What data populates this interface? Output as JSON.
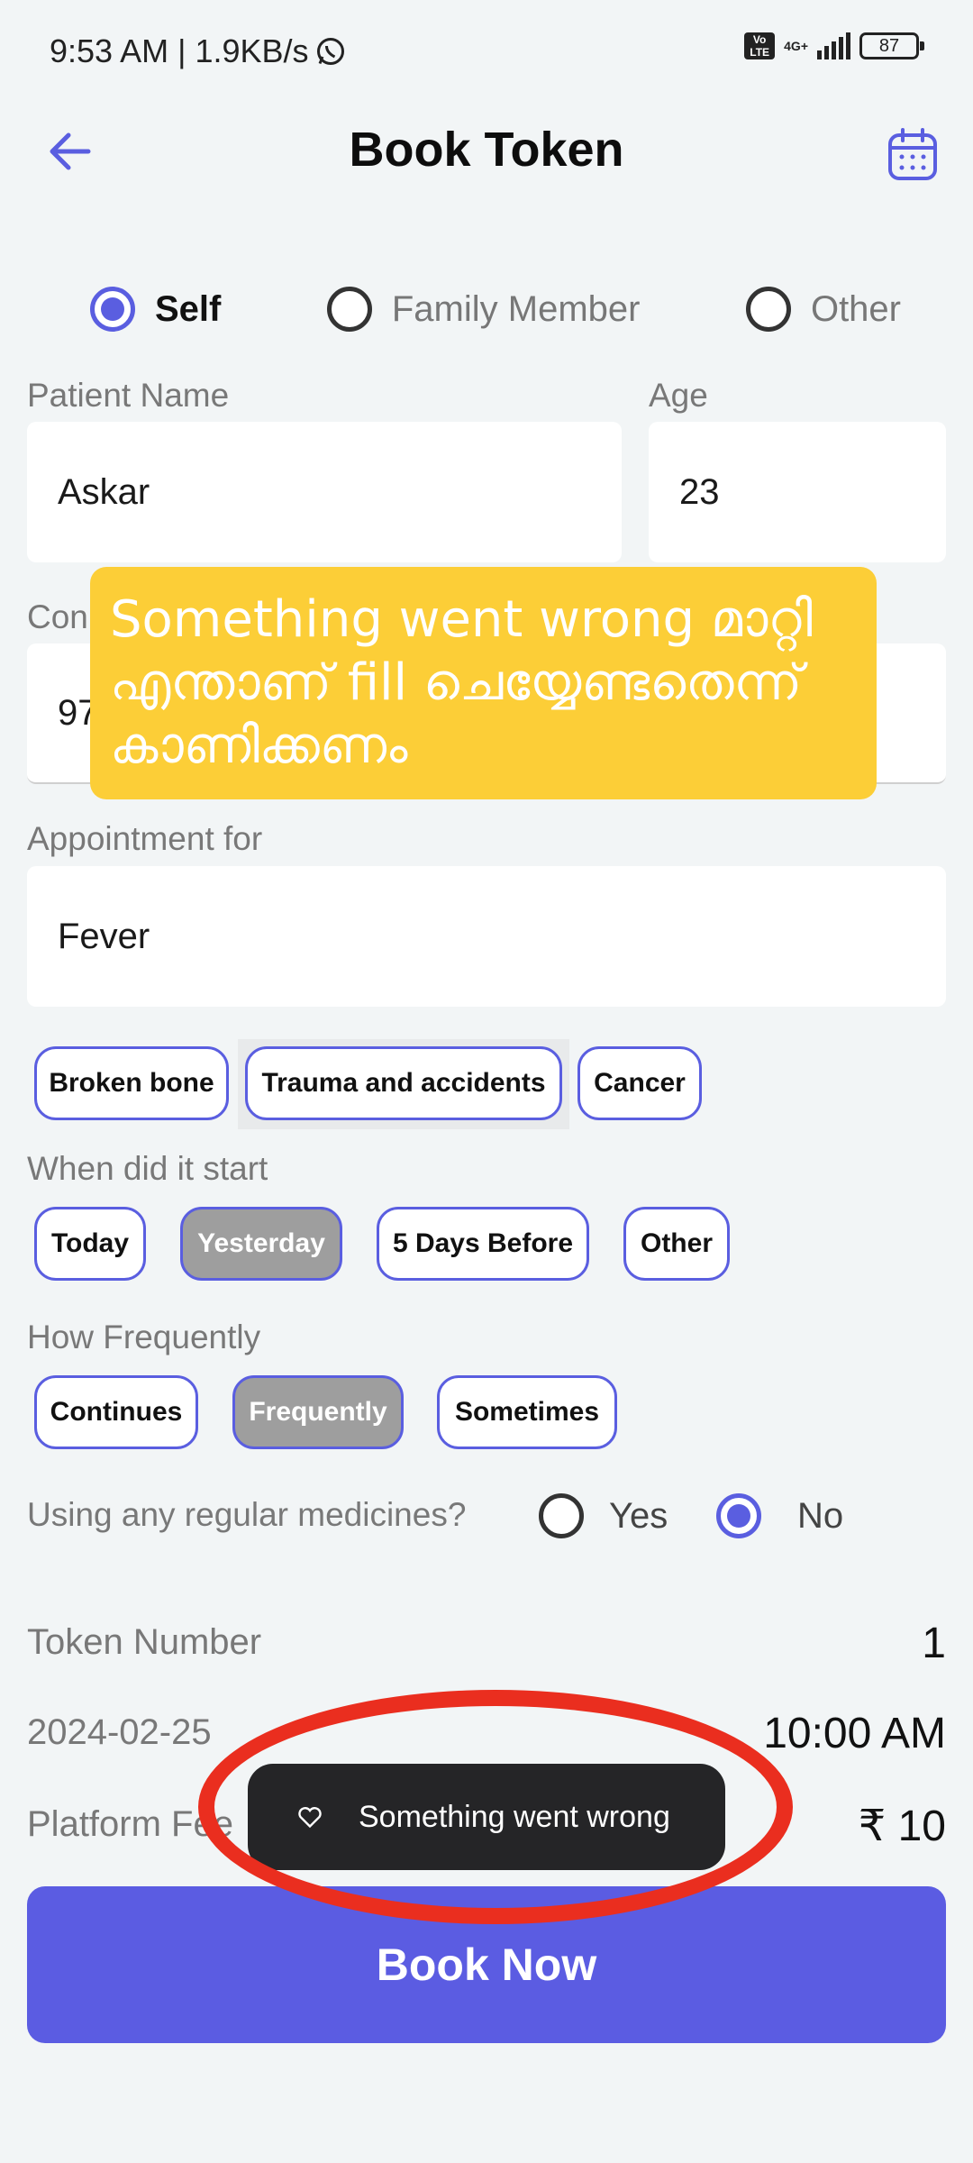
{
  "status_bar": {
    "time": "9:53 AM | 1.9KB/s",
    "volte": "Vo LTE",
    "network": "4G+",
    "battery": "87"
  },
  "header": {
    "title": "Book Token"
  },
  "booking_for": {
    "options": [
      "Self",
      "Family Member",
      "Other"
    ],
    "selected": "Self"
  },
  "patient": {
    "name_label": "Patient Name",
    "name_value": "Askar",
    "age_label": "Age",
    "age_value": "23",
    "contact_label_partial": "Con",
    "contact_value_partial": "97"
  },
  "annotation_note": "Something went wrong മാറ്റി എന്താണ് fill ചെയ്യേണ്ടതെന്ന് കാണിക്കണം",
  "appointment": {
    "label": "Appointment for",
    "value": "Fever"
  },
  "condition_chips": [
    "Broken bone",
    "Trauma and accidents",
    "Cancer"
  ],
  "start": {
    "label": "When did it start",
    "options": [
      "Today",
      "Yesterday",
      "5 Days Before",
      "Other"
    ],
    "selected": "Yesterday"
  },
  "frequency": {
    "label": "How Frequently",
    "options": [
      "Continues",
      "Frequently",
      "Sometimes"
    ],
    "selected": "Frequently"
  },
  "medicines": {
    "label": "Using any regular medicines?",
    "yes": "Yes",
    "no": "No",
    "selected": "No"
  },
  "token": {
    "label": "Token Number",
    "value": "1"
  },
  "schedule": {
    "date": "2024-02-25",
    "time": "10:00 AM"
  },
  "fee": {
    "label": "Platform Fee",
    "value": "₹ 10"
  },
  "snackbar": {
    "message": "Something went wrong"
  },
  "book_button": "Book Now",
  "colors": {
    "accent": "#5a5ee0",
    "annotation": "#fcce37",
    "highlight_ring": "#ea2e1f"
  }
}
